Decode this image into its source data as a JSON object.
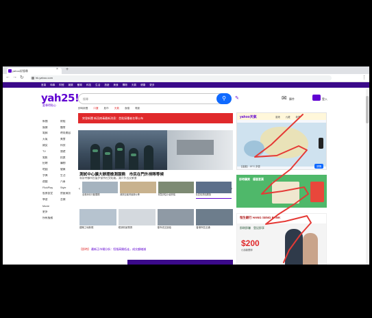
{
  "browser": {
    "tab_title": "yahoo好搜尋",
    "url": "hk.yahoo.com"
  },
  "topnav": {
    "items": [
      "首頁",
      "時事",
      "財經",
      "娛樂",
      "體育",
      "科技",
      "生活",
      "旅遊",
      "美食",
      "購物",
      "天氣",
      "健康",
      "更多"
    ]
  },
  "header": {
    "logo": "yah25!",
    "logo_sub": "愛尋得貼心",
    "search_placeholder": "搜尋",
    "search_icon": "search-icon",
    "mail_label": "郵件",
    "account_label": "登入",
    "trending": [
      "即時新聞",
      "口罩",
      "股市",
      "天氣",
      "食譜",
      "電影"
    ]
  },
  "sidebar": {
    "rows": [
      [
        "新聞",
        "財經"
      ],
      [
        "娛樂",
        "體育"
      ],
      [
        "電郵",
        "時尚美容"
      ],
      [
        "天氣",
        "美食"
      ],
      [
        "婦女",
        "科技"
      ],
      [
        "TV",
        "旅遊"
      ],
      [
        "電影",
        "拍賣"
      ],
      [
        "招聘",
        "購物"
      ],
      [
        "地圖",
        "健康"
      ],
      [
        "字典",
        "生活"
      ],
      [
        "遊戲",
        "汽車"
      ],
      [
        "FlickPlay",
        "Style"
      ],
      [
        "股票設定",
        "房屋資訊"
      ],
      [
        "學習",
        "音樂"
      ],
      [
        "Movie",
        ""
      ],
      [
        "更多",
        ""
      ],
      [
        "所有服務",
        ""
      ]
    ]
  },
  "main": {
    "breaking": "突發新聞  新冠病毒最新消息：首批接種者名單公布",
    "hero_title": "測試中心擴大辦理檢測服務　市民在門外排隊等候",
    "hero_sub": "專家呼籲市民展步保持社交距離，減少外出及聚會",
    "thumbs": [
      "全港消毒行動展開",
      "政府記者會最新公佈",
      "緊急評估小組會議",
      "社區檢測站開放"
    ],
    "cards": [
      "建築工地新規",
      "經濟前景預測",
      "樓市成交回穩",
      "香港市區交通"
    ],
    "bottom_link_hot": "【即時】",
    "bottom_link": "最新正市場分析：恒指高開低走，成交額縮減"
  },
  "weather": {
    "logo": "yahoo天氣",
    "tabs": [
      "香港",
      "九龍",
      "新界"
    ],
    "footer": "【溫度】 19°C  多雲",
    "button": "詳情"
  },
  "ads": {
    "ad1_text": "即時購買　優惠套票",
    "ad2_bank": "恒生銀行  HANG SENG BANK",
    "ad2_promo": "即刷即賺　登記即享",
    "ad2_price": "$200",
    "ad2_tag": "小詩款獨享"
  },
  "colors": {
    "brand": "#6001d2",
    "accent_blue": "#0f69ff",
    "breaking_red": "#e0292b",
    "scribble": "#e53935"
  }
}
